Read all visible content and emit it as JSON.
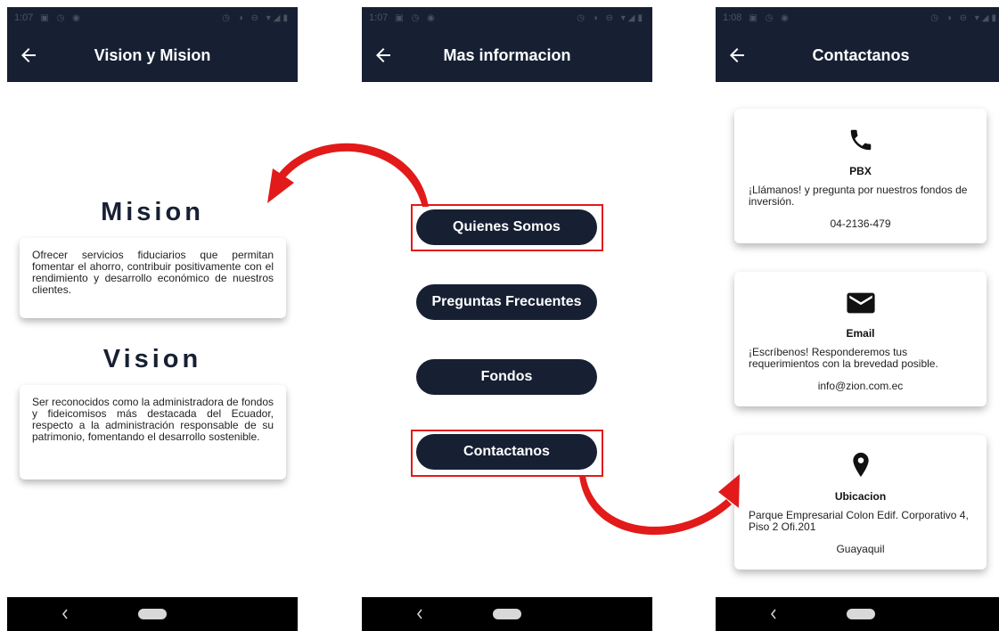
{
  "status_bars": [
    {
      "time": "1:07"
    },
    {
      "time": "1:07"
    },
    {
      "time": "1:08"
    }
  ],
  "screen1": {
    "title": "Vision y Mision",
    "mision_heading": "Mision",
    "mision_text": "Ofrecer servicios fiduciarios que permitan fomentar el ahorro, contribuir positivamente con el rendimiento y desarrollo económico de nuestros clientes.",
    "vision_heading": "Vision",
    "vision_text": "Ser reconocidos como la administradora de fondos y fideicomisos más destacada del Ecuador, respecto a la administración responsable de su patrimonio, fomentando el desarrollo sostenible."
  },
  "screen2": {
    "title": "Mas informacion",
    "buttons": [
      "Quienes Somos",
      "Preguntas Frecuentes",
      "Fondos",
      "Contactanos"
    ]
  },
  "screen3": {
    "title": "Contactanos",
    "cards": [
      {
        "icon": "phone-icon",
        "title": "PBX",
        "description": "¡Llámanos! y  pregunta por nuestros fondos de inversión.",
        "value": "04-2136-479"
      },
      {
        "icon": "mail-icon",
        "title": "Email",
        "description": "¡Escríbenos! Responderemos tus requerimientos con la brevedad posible.",
        "value": "info@zion.com.ec"
      },
      {
        "icon": "location-pin-icon",
        "title": "Ubicacion",
        "description": "Parque Empresarial Colon Edif. Corporativo 4, Piso 2 Ofi.201",
        "value": "Guayaquil"
      }
    ]
  },
  "colors": {
    "appbar": "#172033",
    "button": "#172033",
    "highlight": "#e21a1a",
    "arrow": "#e21a1a",
    "navbar": "#000000"
  }
}
